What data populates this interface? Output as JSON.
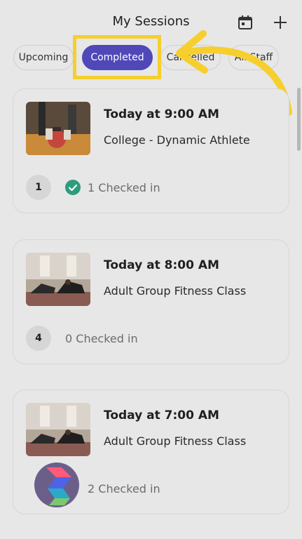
{
  "header": {
    "title": "My Sessions",
    "calendar_icon": "calendar-icon",
    "add_icon": "plus-icon"
  },
  "tabs": [
    {
      "label": "Upcoming",
      "active": false
    },
    {
      "label": "Completed",
      "active": true
    },
    {
      "label": "Cancelled",
      "active": false
    },
    {
      "label": "All Staff",
      "active": false
    }
  ],
  "sessions": [
    {
      "time": "Today at 9:00 AM",
      "name": "College - Dynamic Athlete",
      "count": "1",
      "checked_text": "1 Checked in",
      "has_check": true
    },
    {
      "time": "Today at 8:00 AM",
      "name": "Adult Group Fitness Class",
      "count": "4",
      "checked_text": "0 Checked in",
      "has_check": false
    },
    {
      "time": "Today at 7:00 AM",
      "name": "Adult Group Fitness Class",
      "count": "",
      "checked_text": "2 Checked in",
      "has_check": false
    }
  ],
  "colors": {
    "accent": "#5048b8",
    "highlight": "#f6cf2e",
    "check": "#2e9b7c"
  }
}
